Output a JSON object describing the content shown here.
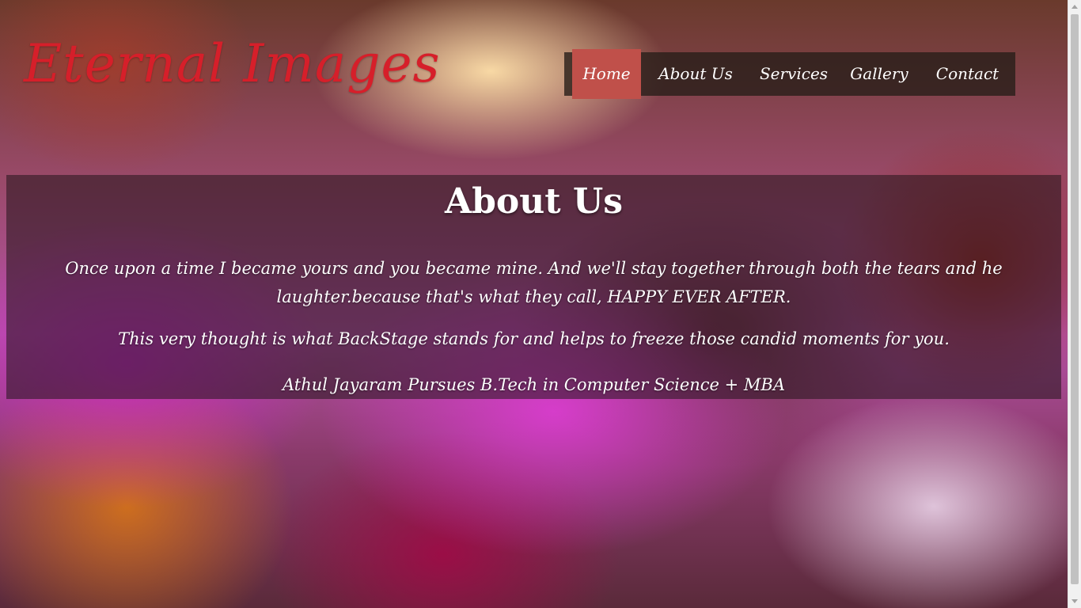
{
  "site": {
    "logo_text": "Eternal Images"
  },
  "nav": {
    "items": [
      {
        "label": "Home",
        "active": true
      },
      {
        "label": "About Us",
        "active": false
      },
      {
        "label": "Services",
        "active": false
      },
      {
        "label": "Gallery",
        "active": false
      },
      {
        "label": "Contact",
        "active": false
      }
    ]
  },
  "about": {
    "title": "About Us",
    "paragraph1": "Once upon a time I became yours and you became mine. And we'll stay together through both the tears and he laughter.because that's what they call, HAPPY EVER AFTER.",
    "paragraph2": "This very thought is what BackStage stands for and helps to freeze those candid moments for you.",
    "paragraph3": "Athul Jayaram Pursues B.Tech in Computer Science + MBA"
  },
  "colors": {
    "logo": "#d61f2a",
    "nav_active": "#c0504a",
    "nav_bg": "#281e19",
    "text": "#ffffff"
  }
}
